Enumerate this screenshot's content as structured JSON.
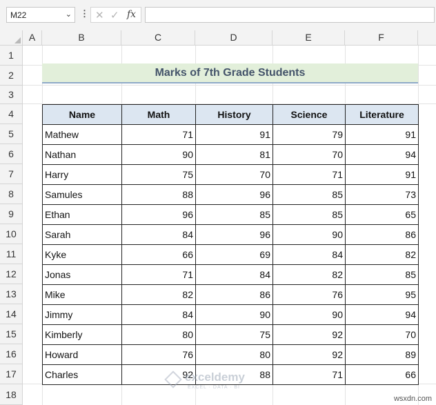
{
  "formula_bar": {
    "name_box": "M22",
    "fx_label": "fx",
    "formula": ""
  },
  "columns": [
    "A",
    "B",
    "C",
    "D",
    "E",
    "F"
  ],
  "rows": [
    "1",
    "2",
    "3",
    "4",
    "5",
    "6",
    "7",
    "8",
    "9",
    "10",
    "11",
    "12",
    "13",
    "14",
    "15",
    "16",
    "17",
    "18"
  ],
  "sheet": {
    "title": "Marks of 7th Grade Students",
    "headers": [
      "Name",
      "Math",
      "History",
      "Science",
      "Literature"
    ],
    "records": [
      [
        "Mathew",
        "71",
        "91",
        "79",
        "91"
      ],
      [
        "Nathan",
        "90",
        "81",
        "70",
        "94"
      ],
      [
        "Harry",
        "75",
        "70",
        "71",
        "91"
      ],
      [
        "Samules",
        "88",
        "96",
        "85",
        "73"
      ],
      [
        "Ethan",
        "96",
        "85",
        "85",
        "65"
      ],
      [
        "Sarah",
        "84",
        "96",
        "90",
        "86"
      ],
      [
        "Kyke",
        "66",
        "69",
        "84",
        "82"
      ],
      [
        "Jonas",
        "71",
        "84",
        "82",
        "85"
      ],
      [
        "Mike",
        "82",
        "86",
        "76",
        "95"
      ],
      [
        "Jimmy",
        "84",
        "90",
        "90",
        "94"
      ],
      [
        "Kimberly",
        "80",
        "75",
        "92",
        "70"
      ],
      [
        "Howard",
        "76",
        "80",
        "92",
        "89"
      ],
      [
        "Charles",
        "92",
        "88",
        "71",
        "66"
      ]
    ]
  },
  "watermark": {
    "name": "exceldemy",
    "tagline": "EXCEL · DATA · BI"
  },
  "site_mark": "wsxdn.com"
}
